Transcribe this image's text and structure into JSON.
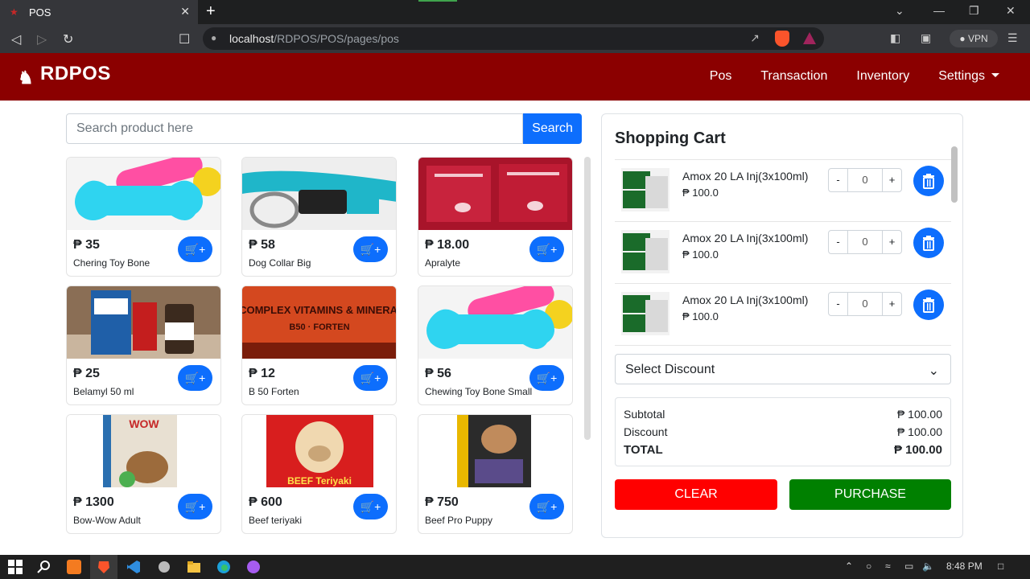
{
  "browser": {
    "tab_title": "POS",
    "tab_close": "✕",
    "new_tab": "+",
    "url_host": "localhost",
    "url_path": "/RDPOS/POS/pages/pos",
    "vpn_label": "VPN"
  },
  "navbar": {
    "brand": "RDPOS",
    "links": [
      "Pos",
      "Transaction",
      "Inventory",
      "Settings"
    ]
  },
  "search": {
    "placeholder": "Search product here",
    "button_label": "Search"
  },
  "products": [
    {
      "price": "₱ 35",
      "name": "Chering Toy Bone"
    },
    {
      "price": "₱ 58",
      "name": "Dog Collar Big"
    },
    {
      "price": "₱ 18.00",
      "name": "Apralyte"
    },
    {
      "price": "₱ 25",
      "name": "Belamyl 50 ml"
    },
    {
      "price": "₱ 12",
      "name": "B 50 Forten"
    },
    {
      "price": "₱ 56",
      "name": "Chewing Toy Bone Small"
    },
    {
      "price": "₱ 1300",
      "name": "Bow-Wow Adult"
    },
    {
      "price": "₱ 600",
      "name": "Beef teriyaki"
    },
    {
      "price": "₱ 750",
      "name": "Beef Pro Puppy"
    }
  ],
  "product_image_texts": {
    "b50": "B-COMPLEX VITAMINS & MINERALS",
    "b50_sub": "B50 · FORTEN",
    "wow": "WOW",
    "beef": "BEEF Teriyaki"
  },
  "cart": {
    "title": "Shopping Cart",
    "items": [
      {
        "name": "Amox 20 LA Inj(3x100ml)",
        "price": "₱ 100.0",
        "qty": "0"
      },
      {
        "name": "Amox 20 LA Inj(3x100ml)",
        "price": "₱ 100.0",
        "qty": "0"
      },
      {
        "name": "Amox 20 LA Inj(3x100ml)",
        "price": "₱ 100.0",
        "qty": "0"
      }
    ],
    "minus": "-",
    "plus": "+",
    "discount_placeholder": "Select Discount",
    "subtotal_label": "Subtotal",
    "subtotal_value": "₱ 100.00",
    "discount_label": "Discount",
    "discount_value": "₱ 100.00",
    "total_label": "TOTAL",
    "total_value": "₱ 100.00",
    "clear_label": "CLEAR",
    "purchase_label": "PURCHASE"
  },
  "taskbar": {
    "time": "8:48 PM"
  },
  "colors": {
    "navbar": "#8b0000",
    "primary": "#0d6efd",
    "clear": "#ff0000",
    "purchase": "#008000"
  }
}
